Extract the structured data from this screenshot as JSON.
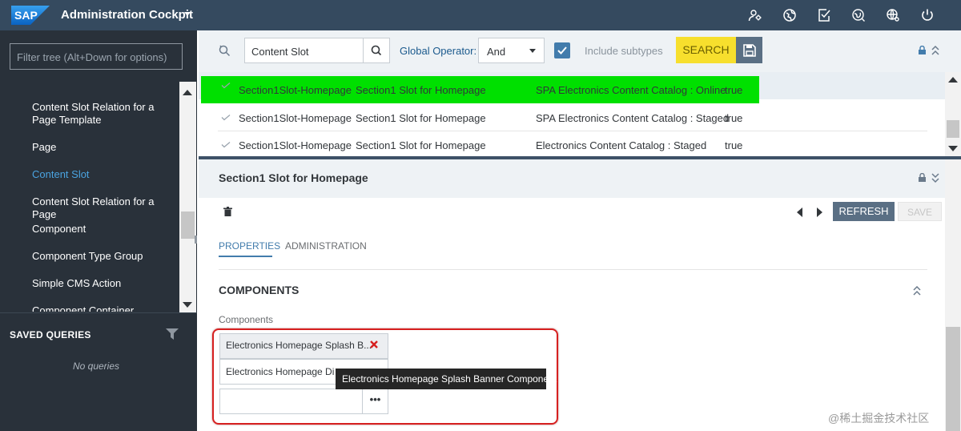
{
  "header": {
    "logo_text": "SAP",
    "app_title": "Administration Cockpit",
    "icons": [
      "user-settings-icon",
      "globe-icon",
      "tasks-check-icon",
      "global-search-icon",
      "settings-globe-icon",
      "power-icon"
    ],
    "bg_color": "#354a5f"
  },
  "sidebar": {
    "filter_placeholder": "Filter tree (Alt+Down for options)",
    "tree_items": [
      {
        "label": "Content Slot Relation for a Page Template",
        "selected": false
      },
      {
        "label": "Page",
        "selected": false
      },
      {
        "label": "Content Slot",
        "selected": true
      },
      {
        "label": "Content Slot Relation for a Page",
        "selected": false
      },
      {
        "label": "Component",
        "selected": false
      },
      {
        "label": "Component Type Group",
        "selected": false
      },
      {
        "label": "Simple CMS Action",
        "selected": false
      },
      {
        "label": "Component Container",
        "selected": false
      }
    ],
    "saved_queries_title": "SAVED QUERIES",
    "no_queries_text": "No queries",
    "selected_color": "#4aa3e0"
  },
  "search": {
    "type_value": "Content Slot",
    "global_operator_label": "Global Operator:",
    "global_operator_value": "And",
    "include_subtypes_label": "Include subtypes",
    "include_subtypes_checked": true,
    "search_button_label": "SEARCH",
    "search_button_color": "#f7df2d"
  },
  "results": {
    "rows": [
      {
        "uid": "Section1Slot-Homepage",
        "name": "Section1 Slot for Homepage",
        "catalog": "SPA Electronics Content Catalog : Online",
        "active": "true",
        "highlighted": true
      },
      {
        "uid": "Section1Slot-Homepage",
        "name": "Section1 Slot for Homepage",
        "catalog": "SPA Electronics Content Catalog : Staged",
        "active": "true",
        "highlighted": false
      },
      {
        "uid": "Section1Slot-Homepage",
        "name": "Section1 Slot for Homepage",
        "catalog": "Electronics Content Catalog : Staged",
        "active": "true",
        "highlighted": false
      }
    ],
    "highlight_color": "#00e000"
  },
  "editor": {
    "title": "Section1 Slot for Homepage",
    "refresh_label": "REFRESH",
    "save_label": "SAVE",
    "tabs": [
      {
        "label": "PROPERTIES",
        "active": true
      },
      {
        "label": "ADMINISTRATION",
        "active": false
      }
    ],
    "section_title": "COMPONENTS",
    "components_label": "Components",
    "components": [
      "Electronics Homepage Splash B...",
      "Electronics Homepage Di"
    ],
    "add_button_label": "•••",
    "tooltip": "Electronics Homepage Splash Banner Component",
    "accent_color": "#427cac"
  },
  "watermark": "@稀土掘金技术社区"
}
